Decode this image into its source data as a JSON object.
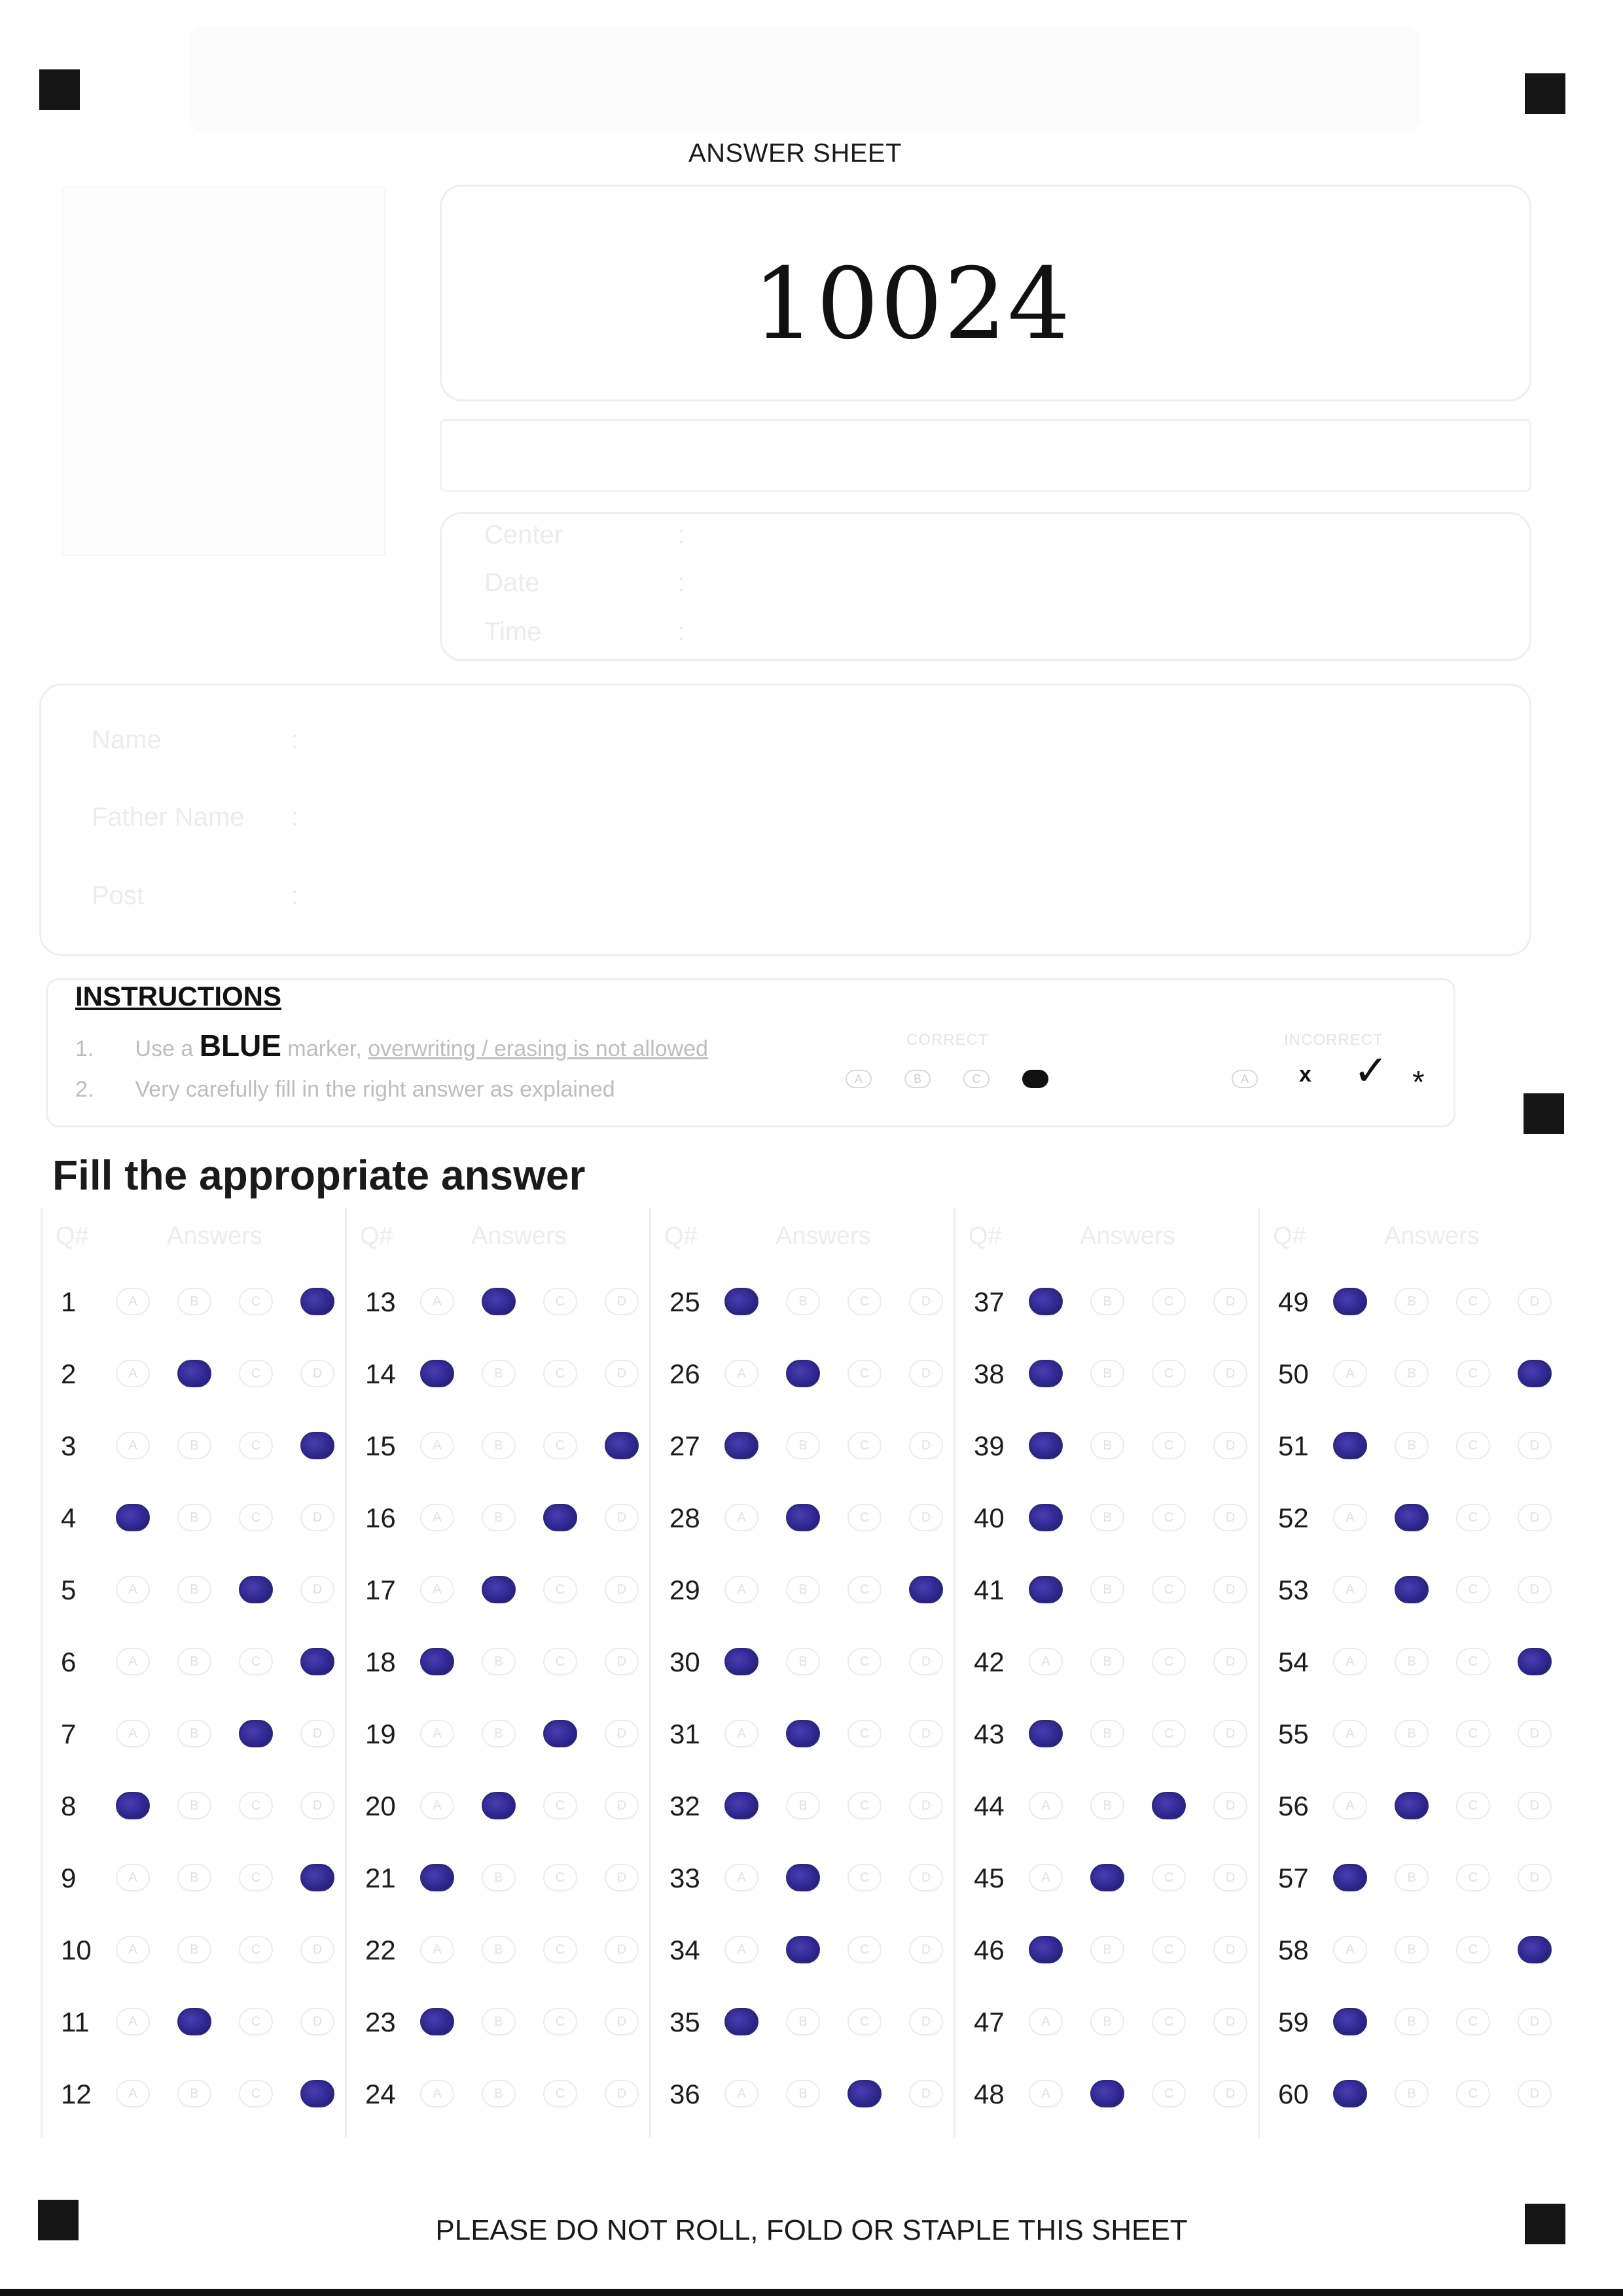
{
  "header": {
    "title": "ANSWER SHEET",
    "roll_number": "10024"
  },
  "form_fields": [
    {
      "label": "Center",
      "separator": ":"
    },
    {
      "label": "Date",
      "separator": ":"
    },
    {
      "label": "Time",
      "separator": ":"
    }
  ],
  "candidate_fields": [
    {
      "label": "Name",
      "separator": ":"
    },
    {
      "label": "Father Name",
      "separator": ":"
    },
    {
      "label": "Post",
      "separator": ":"
    }
  ],
  "instructions": {
    "heading": "INSTRUCTIONS",
    "items": [
      {
        "num": "1.",
        "pre": "Use a",
        "emph": "BLUE",
        "mid": "marker,",
        "underlined": "overwriting / erasing is not allowed"
      },
      {
        "num": "2.",
        "text": "Very carefully fill in the right answer as explained"
      }
    ],
    "correct_label": "CORRECT",
    "incorrect_label": "INCORRECT",
    "choices": [
      "A",
      "B",
      "C",
      "D"
    ],
    "incorrect_marks": [
      "x",
      "✓",
      "*"
    ]
  },
  "section_title": "Fill the appropriate answer",
  "grid_headers": {
    "q": "Q#",
    "answers": "Answers"
  },
  "answers": [
    {
      "q": "1",
      "marked": "D"
    },
    {
      "q": "2",
      "marked": "B"
    },
    {
      "q": "3",
      "marked": "D"
    },
    {
      "q": "4",
      "marked": "A"
    },
    {
      "q": "5",
      "marked": "C"
    },
    {
      "q": "6",
      "marked": "D"
    },
    {
      "q": "7",
      "marked": "C"
    },
    {
      "q": "8",
      "marked": "A"
    },
    {
      "q": "9",
      "marked": "D"
    },
    {
      "q": "10",
      "marked": ""
    },
    {
      "q": "11",
      "marked": "B"
    },
    {
      "q": "12",
      "marked": "D"
    },
    {
      "q": "13",
      "marked": "B"
    },
    {
      "q": "14",
      "marked": "A"
    },
    {
      "q": "15",
      "marked": "D"
    },
    {
      "q": "16",
      "marked": "C"
    },
    {
      "q": "17",
      "marked": "B"
    },
    {
      "q": "18",
      "marked": "A"
    },
    {
      "q": "19",
      "marked": "C"
    },
    {
      "q": "20",
      "marked": "B"
    },
    {
      "q": "21",
      "marked": "A"
    },
    {
      "q": "22",
      "marked": ""
    },
    {
      "q": "23",
      "marked": "A"
    },
    {
      "q": "24",
      "marked": ""
    },
    {
      "q": "25",
      "marked": "A"
    },
    {
      "q": "26",
      "marked": "B"
    },
    {
      "q": "27",
      "marked": "A"
    },
    {
      "q": "28",
      "marked": "B"
    },
    {
      "q": "29",
      "marked": "D"
    },
    {
      "q": "30",
      "marked": "A"
    },
    {
      "q": "31",
      "marked": "B"
    },
    {
      "q": "32",
      "marked": "A"
    },
    {
      "q": "33",
      "marked": "B"
    },
    {
      "q": "34",
      "marked": "B"
    },
    {
      "q": "35",
      "marked": "A"
    },
    {
      "q": "36",
      "marked": "C"
    },
    {
      "q": "37",
      "marked": "A"
    },
    {
      "q": "38",
      "marked": "A"
    },
    {
      "q": "39",
      "marked": "A"
    },
    {
      "q": "40",
      "marked": "A"
    },
    {
      "q": "41",
      "marked": "A"
    },
    {
      "q": "42",
      "marked": ""
    },
    {
      "q": "43",
      "marked": "A"
    },
    {
      "q": "44",
      "marked": "C"
    },
    {
      "q": "45",
      "marked": "B"
    },
    {
      "q": "46",
      "marked": "A"
    },
    {
      "q": "47",
      "marked": ""
    },
    {
      "q": "48",
      "marked": "B"
    },
    {
      "q": "49",
      "marked": "A"
    },
    {
      "q": "50",
      "marked": "D"
    },
    {
      "q": "51",
      "marked": "A"
    },
    {
      "q": "52",
      "marked": "B"
    },
    {
      "q": "53",
      "marked": "B"
    },
    {
      "q": "54",
      "marked": "D"
    },
    {
      "q": "55",
      "marked": ""
    },
    {
      "q": "56",
      "marked": "B"
    },
    {
      "q": "57",
      "marked": "A"
    },
    {
      "q": "58",
      "marked": "D"
    },
    {
      "q": "59",
      "marked": "A"
    },
    {
      "q": "60",
      "marked": "A"
    }
  ],
  "colors": {
    "ink": "#2f2890",
    "faint": "#ececec"
  },
  "footer": "PLEASE DO NOT ROLL, FOLD OR STAPLE THIS SHEET"
}
